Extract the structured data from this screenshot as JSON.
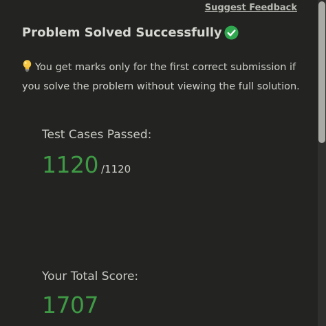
{
  "header": {
    "feedback_link": "Suggest Feedback"
  },
  "result": {
    "title": "Problem Solved Successfully",
    "status_icon": "check-circle-icon",
    "note_icon": "lightbulb-icon",
    "note": "You get marks only for the first correct submission if you solve the problem without viewing the full solution."
  },
  "test_cases": {
    "label": "Test Cases Passed:",
    "passed": "1120",
    "total": "/1120"
  },
  "score": {
    "label": "Your Total Score:",
    "value": "1707"
  },
  "colors": {
    "background": "#232421",
    "success_green": "#3f9a45",
    "text": "#d8d8d4"
  }
}
